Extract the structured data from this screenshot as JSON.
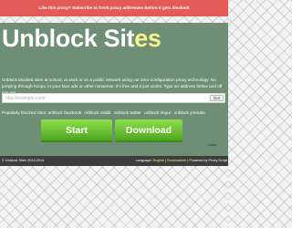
{
  "topbar": {
    "lead": "Like this proxy?",
    "message": "Subscribe to fresh proxy addresses before it gets blocked!"
  },
  "logo": {
    "part1": "Unblock Sit",
    "part2": "es"
  },
  "description": "Unblock blocked sites at school, at work or on a public network using our zero-configuration proxy technology. No jumping through hoops, in your face ads or other nonsense: it's free and it just works. Type an address below and off you go!",
  "url": {
    "placeholder": "http://example.com/",
    "go_label": "Go!"
  },
  "popular": {
    "label": "Popularly blocked sites:",
    "items": [
      "unblock facebook",
      "unblock reddit",
      "unblock twitter",
      "unblock imgur",
      "unblock youtube"
    ]
  },
  "buttons": {
    "start": "Start",
    "download": "Download"
  },
  "lang_mini": "Links",
  "footer": {
    "copyright": "© Unblock Sites 2013-2014",
    "language_label": "Language:",
    "language_value": "English",
    "bookmarklet": "Bookmarklet",
    "powered": "Powered by Proxy Script"
  },
  "colors": {
    "topbar": "#e45a57",
    "panel": "#6e8e75",
    "accent_yellow": "#f4f48a",
    "button_green": "#4ea520",
    "footer": "#3a3f3b"
  }
}
